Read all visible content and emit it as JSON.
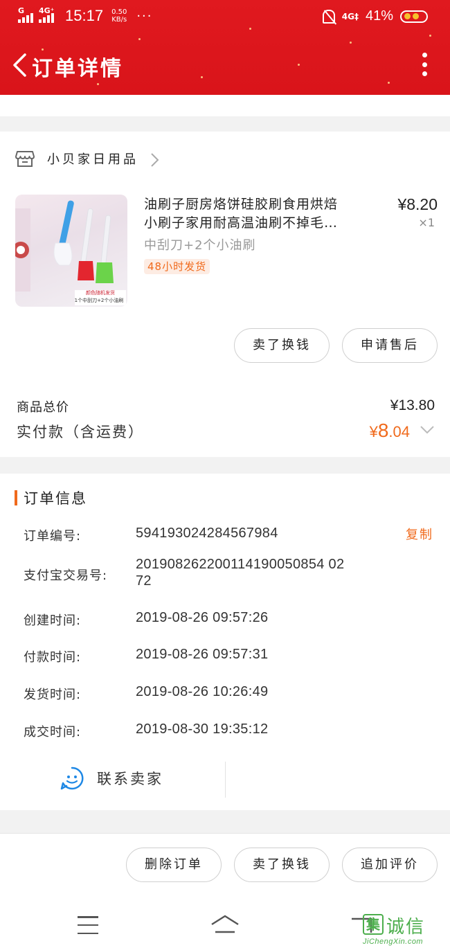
{
  "status_bar": {
    "network_left": "G",
    "network_4g": "4G⁺",
    "time": "15:17",
    "speed_value": "0.50",
    "speed_unit": "KB/s",
    "more": "···",
    "network_right": "4G‡",
    "battery_percent": "41%"
  },
  "header": {
    "title": "订单详情"
  },
  "shop": {
    "name": "小贝家日用品"
  },
  "product": {
    "title_line1": "油刷子厨房烙饼硅胶刷食用烘焙",
    "title_line2": "小刷子家用耐高温油刷不掉毛…",
    "price": "¥8.20",
    "quantity": "×1",
    "spec": "中刮刀+2个小油刷",
    "ship_badge": "48小时发货",
    "image_caption_line1": "颜色随机发货",
    "image_caption_line2": "1个中刮刀+2个小油刷"
  },
  "item_actions": {
    "resell": "卖了换钱",
    "after_sales": "申请售后"
  },
  "totals": {
    "goods_total_label": "商品总价",
    "goods_total_value": "¥13.80",
    "paid_label": "实付款（含运费）",
    "paid_currency": "¥",
    "paid_integer": "8",
    "paid_decimal": ".04"
  },
  "order_info": {
    "title": "订单信息",
    "copy": "复制",
    "rows": [
      {
        "label": "订单编号:",
        "value": "594193024284567984"
      },
      {
        "label": "支付宝交易号:",
        "value_line1": "201908262200114190050854 02",
        "value_line2": "72"
      },
      {
        "label": "创建时间:",
        "value": "2019-08-26 09:57:26"
      },
      {
        "label": "付款时间:",
        "value": "2019-08-26 09:57:31"
      },
      {
        "label": "发货时间:",
        "value": "2019-08-26 10:26:49"
      },
      {
        "label": "成交时间:",
        "value": "2019-08-30 19:35:12"
      }
    ]
  },
  "contact": {
    "label": "联系卖家"
  },
  "bottom_actions": {
    "delete": "删除订单",
    "resell": "卖了换钱",
    "review": "追加评价"
  },
  "watermark": {
    "badge": "集",
    "text": "诚信",
    "url": "JiChengXin.com"
  },
  "colors": {
    "header_red": "#d9141a",
    "accent_orange": "#f06a1c",
    "badge_bg": "#fdece3",
    "contact_blue": "#1e88e5"
  }
}
